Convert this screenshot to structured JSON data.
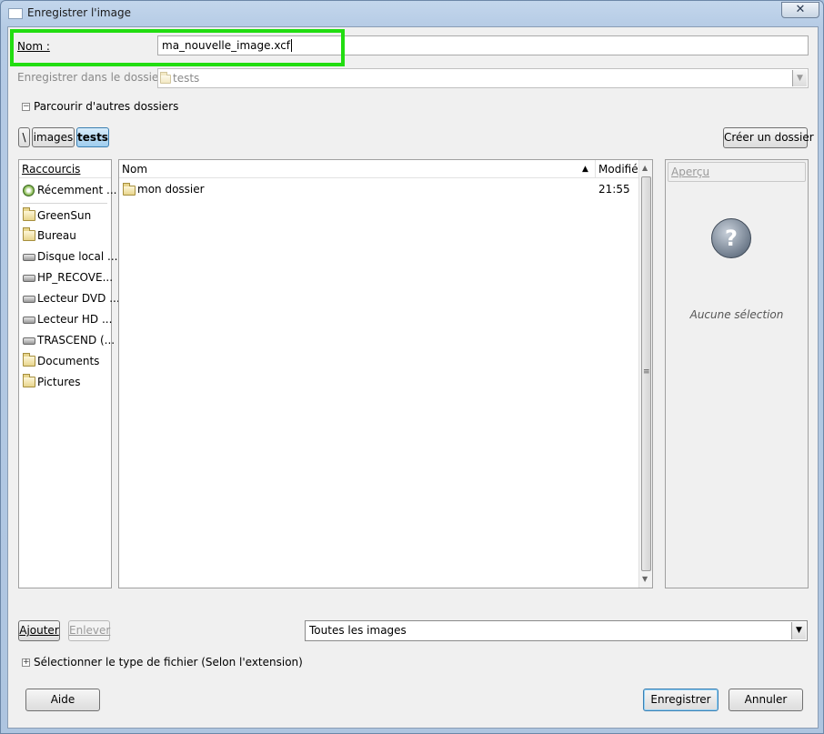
{
  "window": {
    "title": "Enregistrer l'image",
    "close_glyph": "✕"
  },
  "name_row": {
    "label": "Nom :",
    "value": "ma_nouvelle_image.xcf"
  },
  "save_in_row": {
    "label": "Enregistrer dans le dossier :",
    "value": "tests"
  },
  "browse": {
    "label": "Parcourir d'autres dossiers",
    "expander_glyph": "−"
  },
  "path_bar": {
    "root_label": "\\",
    "crumbs": [
      "images",
      "tests"
    ]
  },
  "create_folder_label": "Créer un dossier",
  "places": {
    "header": "Raccourcis",
    "items": [
      {
        "label": "Récemment ...",
        "icon": "recent-icon"
      },
      {
        "label": "GreenSun",
        "icon": "folder-icon"
      },
      {
        "label": "Bureau",
        "icon": "folder-icon"
      },
      {
        "label": "Disque local ...",
        "icon": "drive-icon"
      },
      {
        "label": "HP_RECOVE...",
        "icon": "drive-icon"
      },
      {
        "label": "Lecteur DVD ...",
        "icon": "dvd-drive-icon"
      },
      {
        "label": "Lecteur HD ...",
        "icon": "drive-icon"
      },
      {
        "label": "TRASCEND (...",
        "icon": "drive-icon"
      },
      {
        "label": "Documents",
        "icon": "folder-icon"
      },
      {
        "label": "Pictures",
        "icon": "folder-icon"
      }
    ]
  },
  "files": {
    "columns": {
      "name": "Nom",
      "modified": "Modifié",
      "sort_glyph": "▲"
    },
    "rows": [
      {
        "name": "mon dossier",
        "modified": "21:55"
      }
    ],
    "scroll_up": "▲",
    "scroll_down": "▼",
    "grip": "≡"
  },
  "preview": {
    "header": "Aperçu",
    "empty_text": "Aucune sélection"
  },
  "add_label": "Ajouter",
  "remove_label": "Enlever",
  "filter": {
    "value": "Toutes les images",
    "arrow_glyph": "▼"
  },
  "file_type": {
    "label": "Sélectionner le type de fichier (Selon l'extension)",
    "expander_glyph": "+"
  },
  "help_label": "Aide",
  "save_label": "Enregistrer",
  "cancel_label": "Annuler",
  "colors": {
    "highlight": "#22dd11",
    "active_crumb": "#9fcdee"
  }
}
